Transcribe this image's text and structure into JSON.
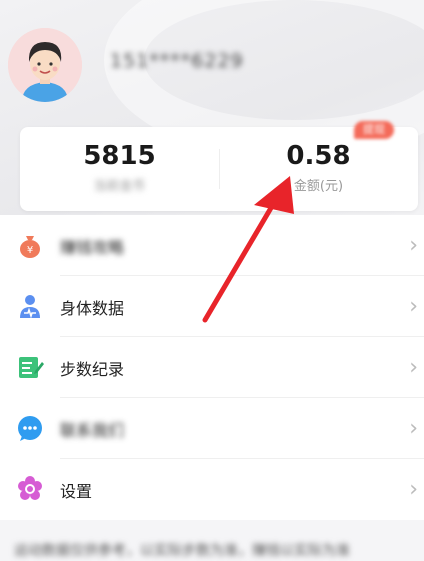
{
  "profile": {
    "phone": "151****6229"
  },
  "stats": {
    "left_value": "5815",
    "left_label": "当前金币",
    "right_value": "0.58",
    "right_label": "金额(元)",
    "badge_label": "提现"
  },
  "menu": {
    "items": [
      {
        "label": "赚钱攻略",
        "icon": "money-bag-icon",
        "color": "#f07a5a"
      },
      {
        "label": "身体数据",
        "icon": "person-health-icon",
        "color": "#5b8ff0"
      },
      {
        "label": "步数纪录",
        "icon": "edit-record-icon",
        "color": "#3cc27a"
      },
      {
        "label": "联系我们",
        "icon": "chat-bubble-icon",
        "color": "#2f9cf0"
      },
      {
        "label": "设置",
        "icon": "flower-settings-icon",
        "color": "#d65cd4"
      }
    ],
    "chevron": "›"
  },
  "footer": {
    "text": "运动数据仅供参考，以实际步数为准，赚钱以实际为准"
  },
  "colors": {
    "arrow": "#e8242a"
  }
}
